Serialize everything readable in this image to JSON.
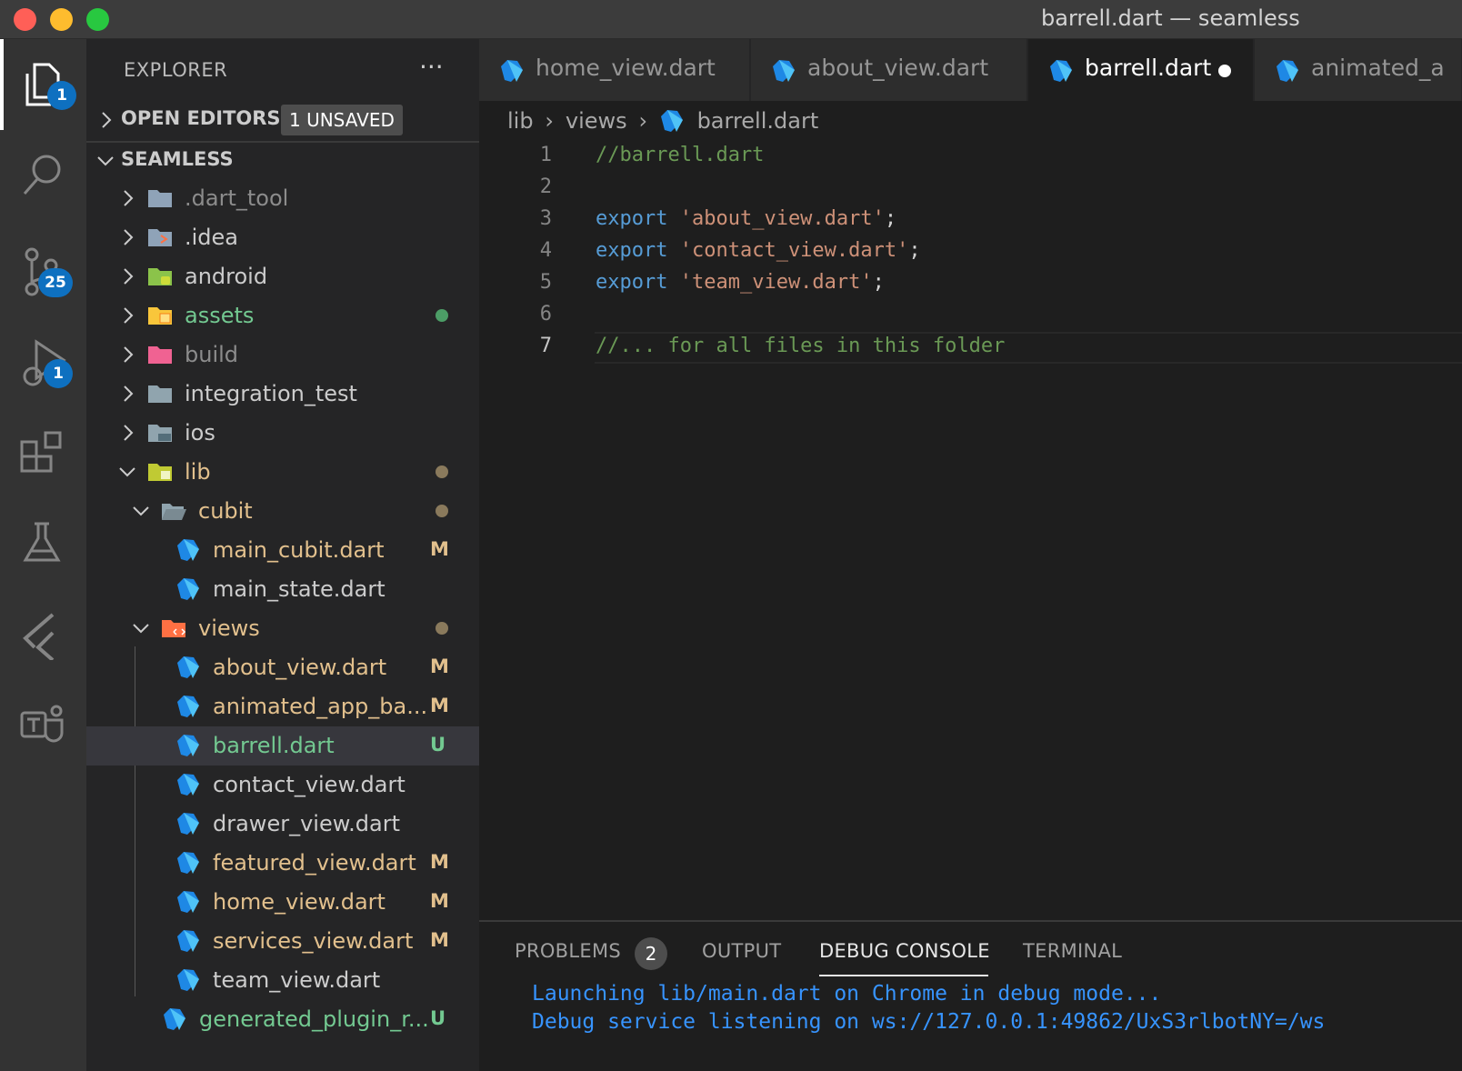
{
  "window": {
    "title": "barrell.dart — seamless"
  },
  "activity_bar": {
    "explorer_badge": "1",
    "scm_badge": "25",
    "debug_badge": "1"
  },
  "sidebar": {
    "title": "EXPLORER",
    "more_actions": "···",
    "open_editors": {
      "label": "OPEN EDITORS",
      "badge": "1 UNSAVED"
    },
    "project": {
      "label": "SEAMLESS"
    },
    "tree": [
      {
        "name": ".dart_tool",
        "decoration": ""
      },
      {
        "name": ".idea",
        "decoration": ""
      },
      {
        "name": "android",
        "decoration": ""
      },
      {
        "name": "assets",
        "decoration": ""
      },
      {
        "name": "build",
        "decoration": ""
      },
      {
        "name": "integration_test",
        "decoration": ""
      },
      {
        "name": "ios",
        "decoration": ""
      },
      {
        "name": "lib",
        "decoration": ""
      },
      {
        "name": "cubit",
        "decoration": ""
      },
      {
        "name": "main_cubit.dart",
        "decoration": "M"
      },
      {
        "name": "main_state.dart",
        "decoration": ""
      },
      {
        "name": "views",
        "decoration": ""
      },
      {
        "name": "about_view.dart",
        "decoration": "M"
      },
      {
        "name": "animated_app_ba...",
        "decoration": "M"
      },
      {
        "name": "barrell.dart",
        "decoration": "U"
      },
      {
        "name": "contact_view.dart",
        "decoration": ""
      },
      {
        "name": "drawer_view.dart",
        "decoration": ""
      },
      {
        "name": "featured_view.dart",
        "decoration": "M"
      },
      {
        "name": "home_view.dart",
        "decoration": "M"
      },
      {
        "name": "services_view.dart",
        "decoration": "M"
      },
      {
        "name": "team_view.dart",
        "decoration": ""
      },
      {
        "name": "generated_plugin_r...",
        "decoration": "U"
      }
    ]
  },
  "tabs": [
    {
      "label": "home_view.dart"
    },
    {
      "label": "about_view.dart"
    },
    {
      "label": "barrell.dart"
    },
    {
      "label": "animated_a"
    }
  ],
  "breadcrumb": {
    "parts": [
      "lib",
      "views",
      "barrell.dart"
    ]
  },
  "editor": {
    "line_numbers": [
      "1",
      "2",
      "3",
      "4",
      "5",
      "6",
      "7"
    ],
    "line1": {
      "comment": "//barrell.dart"
    },
    "line3": {
      "kw": "export",
      "str": "'about_view.dart'",
      "punc": ";"
    },
    "line4": {
      "kw": "export",
      "str": "'contact_view.dart'",
      "punc": ";"
    },
    "line5": {
      "kw": "export",
      "str": "'team_view.dart'",
      "punc": ";"
    },
    "line7": {
      "comment": "//... for all files in this folder"
    }
  },
  "panel": {
    "tabs": [
      "PROBLEMS",
      "OUTPUT",
      "DEBUG CONSOLE",
      "TERMINAL"
    ],
    "problems_count": "2",
    "console": [
      "Launching lib/main.dart on Chrome in debug mode...",
      "Debug service listening on ws://127.0.0.1:49862/UxS3rlbotNY=/ws"
    ]
  },
  "colors": {
    "accent": "#0e70c0",
    "git_untracked": "#73c991",
    "git_modified": "#e2c08d",
    "comment": "#6a9955",
    "keyword": "#569cd6",
    "string": "#ce9178"
  }
}
